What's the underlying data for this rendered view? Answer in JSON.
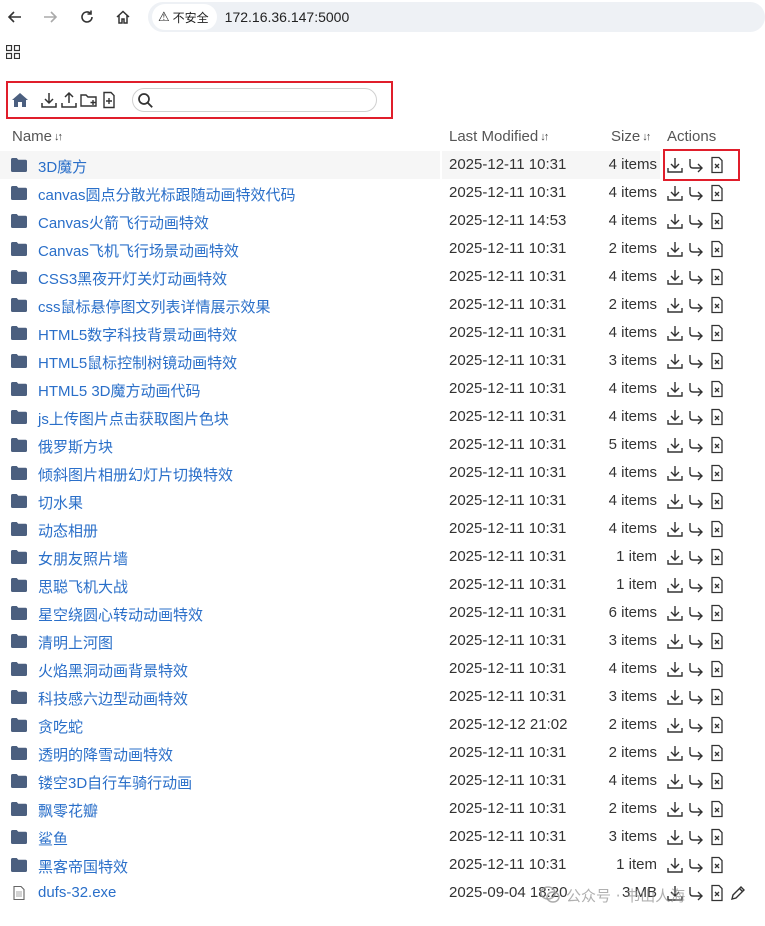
{
  "browser": {
    "security_label": "不安全",
    "url": "172.16.36.147:5000"
  },
  "toolbar": {
    "search_placeholder": ""
  },
  "table": {
    "headers": {
      "name": "Name",
      "modified": "Last Modified",
      "size": "Size",
      "actions": "Actions"
    },
    "rows": [
      {
        "name": "3D魔方",
        "modified": "2025-12-11 10:31",
        "size": "4 items",
        "type": "folder"
      },
      {
        "name": "canvas圆点分散光标跟随动画特效代码",
        "modified": "2025-12-11 10:31",
        "size": "4 items",
        "type": "folder"
      },
      {
        "name": "Canvas火箭飞行动画特效",
        "modified": "2025-12-11 14:53",
        "size": "4 items",
        "type": "folder"
      },
      {
        "name": "Canvas飞机飞行场景动画特效",
        "modified": "2025-12-11 10:31",
        "size": "2 items",
        "type": "folder"
      },
      {
        "name": "CSS3黑夜开灯关灯动画特效",
        "modified": "2025-12-11 10:31",
        "size": "4 items",
        "type": "folder"
      },
      {
        "name": "css鼠标悬停图文列表详情展示效果",
        "modified": "2025-12-11 10:31",
        "size": "2 items",
        "type": "folder"
      },
      {
        "name": "HTML5数字科技背景动画特效",
        "modified": "2025-12-11 10:31",
        "size": "4 items",
        "type": "folder"
      },
      {
        "name": "HTML5鼠标控制树镜动画特效",
        "modified": "2025-12-11 10:31",
        "size": "3 items",
        "type": "folder"
      },
      {
        "name": "HTML5 3D魔方动画代码",
        "modified": "2025-12-11 10:31",
        "size": "4 items",
        "type": "folder"
      },
      {
        "name": "js上传图片点击获取图片色块",
        "modified": "2025-12-11 10:31",
        "size": "4 items",
        "type": "folder"
      },
      {
        "name": "俄罗斯方块",
        "modified": "2025-12-11 10:31",
        "size": "5 items",
        "type": "folder"
      },
      {
        "name": "倾斜图片相册幻灯片切换特效",
        "modified": "2025-12-11 10:31",
        "size": "4 items",
        "type": "folder"
      },
      {
        "name": "切水果",
        "modified": "2025-12-11 10:31",
        "size": "4 items",
        "type": "folder"
      },
      {
        "name": "动态相册",
        "modified": "2025-12-11 10:31",
        "size": "4 items",
        "type": "folder"
      },
      {
        "name": "女朋友照片墙",
        "modified": "2025-12-11 10:31",
        "size": "1 item",
        "type": "folder"
      },
      {
        "name": "思聪飞机大战",
        "modified": "2025-12-11 10:31",
        "size": "1 item",
        "type": "folder"
      },
      {
        "name": "星空绕圆心转动动画特效",
        "modified": "2025-12-11 10:31",
        "size": "6 items",
        "type": "folder"
      },
      {
        "name": "清明上河图",
        "modified": "2025-12-11 10:31",
        "size": "3 items",
        "type": "folder"
      },
      {
        "name": "火焰黑洞动画背景特效",
        "modified": "2025-12-11 10:31",
        "size": "4 items",
        "type": "folder"
      },
      {
        "name": "科技感六边型动画特效",
        "modified": "2025-12-11 10:31",
        "size": "3 items",
        "type": "folder"
      },
      {
        "name": "贪吃蛇",
        "modified": "2025-12-12 21:02",
        "size": "2 items",
        "type": "folder"
      },
      {
        "name": "透明的降雪动画特效",
        "modified": "2025-12-11 10:31",
        "size": "2 items",
        "type": "folder"
      },
      {
        "name": "镂空3D自行车骑行动画",
        "modified": "2025-12-11 10:31",
        "size": "4 items",
        "type": "folder"
      },
      {
        "name": "飘零花瓣",
        "modified": "2025-12-11 10:31",
        "size": "2 items",
        "type": "folder"
      },
      {
        "name": "鲨鱼",
        "modified": "2025-12-11 10:31",
        "size": "3 items",
        "type": "folder"
      },
      {
        "name": "黑客帝国特效",
        "modified": "2025-12-11 10:31",
        "size": "1 item",
        "type": "folder"
      },
      {
        "name": "dufs-32.exe",
        "modified": "2025-09-04 18:20",
        "size": "3 MB",
        "type": "file"
      }
    ]
  },
  "watermark": {
    "text": "公众号 · 书山人海"
  },
  "colors": {
    "link": "#2a6fc9",
    "folder_icon": "#4b5f7f",
    "highlight_border": "#e01e2b"
  }
}
